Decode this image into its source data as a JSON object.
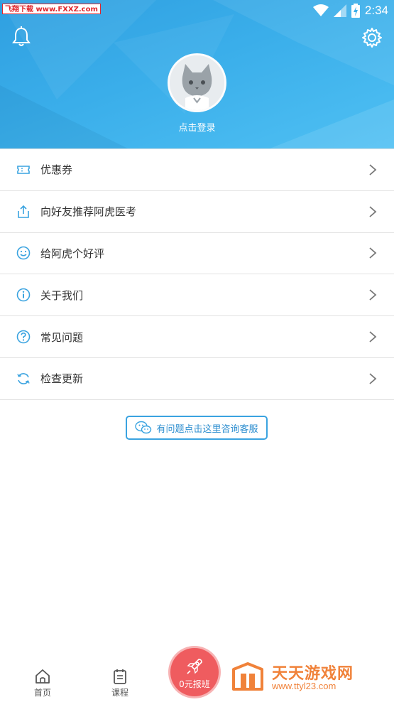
{
  "watermark": "飞翔下载 www.FXXZ.com",
  "status_bar": {
    "time": "2:34"
  },
  "header": {
    "login_text": "点击登录"
  },
  "menu": {
    "items": [
      {
        "label": "优惠券",
        "icon": "ticket-icon"
      },
      {
        "label": "向好友推荐阿虎医考",
        "icon": "share-icon"
      },
      {
        "label": "给阿虎个好评",
        "icon": "smile-icon"
      },
      {
        "label": "关于我们",
        "icon": "info-icon"
      },
      {
        "label": "常见问题",
        "icon": "question-icon"
      },
      {
        "label": "检查更新",
        "icon": "refresh-icon"
      }
    ]
  },
  "consult_button": {
    "label": "有问题点击这里咨询客服",
    "icon": "wechat-icon"
  },
  "tabbar": {
    "home_label": "首页",
    "courses_label": "课程",
    "signup_label": "0元报班"
  },
  "site_logo": {
    "title": "天天游戏网",
    "url": "www.ttyl23.com"
  },
  "colors": {
    "header_blue": "#3aaeea",
    "accent_blue": "#3aa3e0",
    "signup_red": "#ef5c5f",
    "logo_orange": "#f0823a"
  }
}
